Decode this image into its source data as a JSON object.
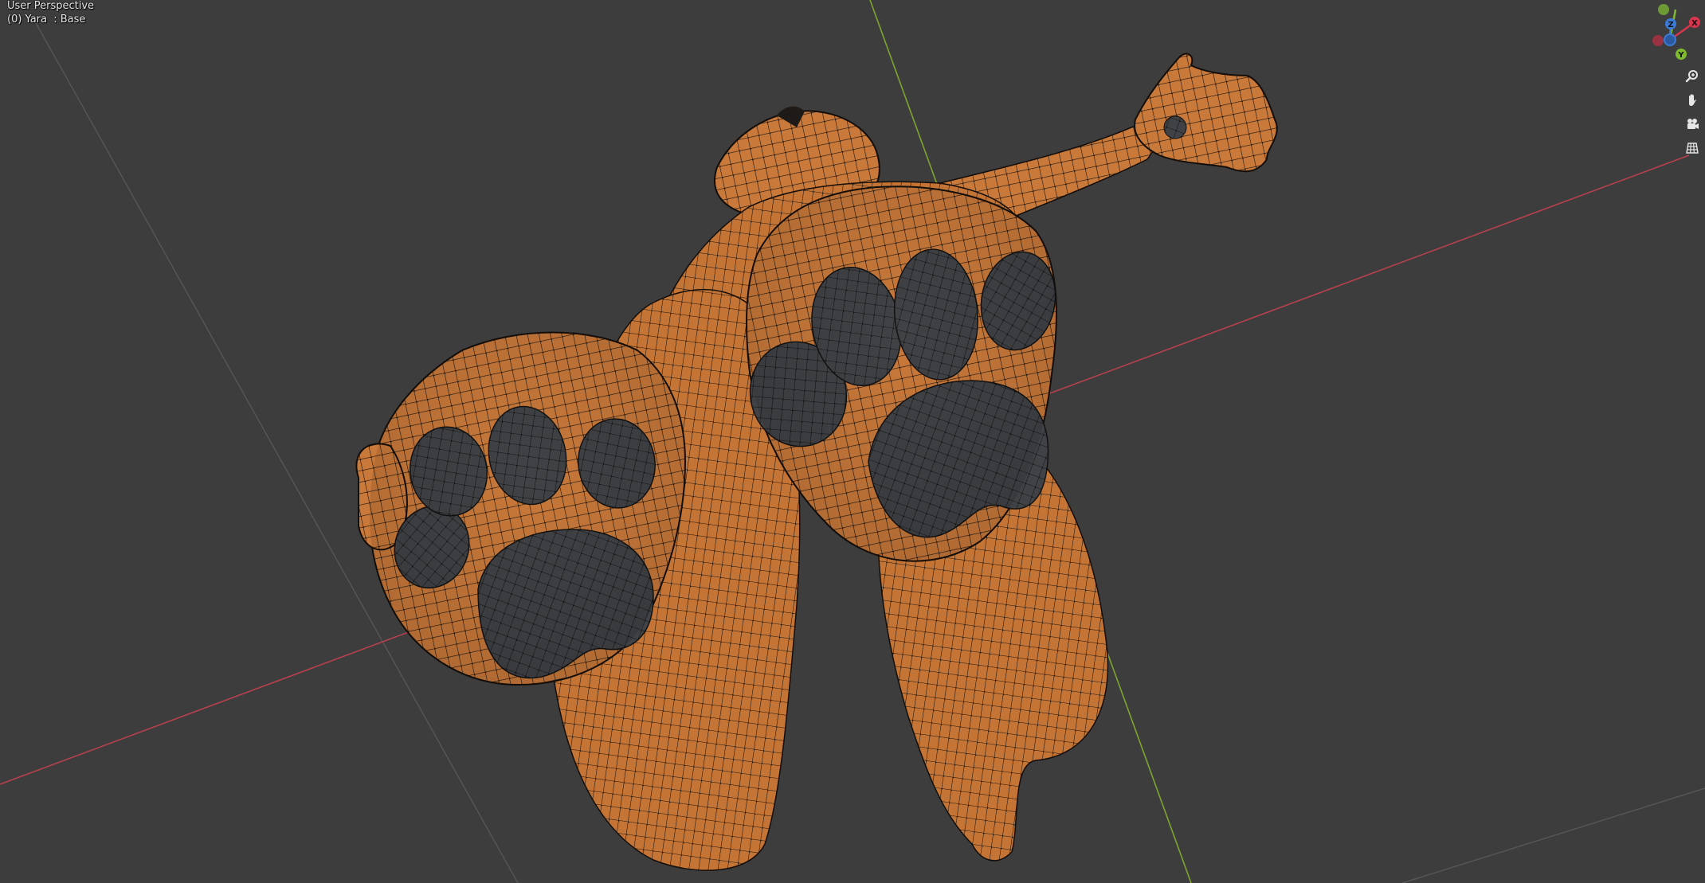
{
  "viewport": {
    "view_name": "User Perspective",
    "object_info": "(0) Yara  : Base"
  },
  "gizmo": {
    "x_label": "X",
    "y_label": "Y",
    "z_label": "Z",
    "colors": {
      "x": "#d9364d",
      "y": "#7fba2e",
      "z": "#3b7bd8",
      "x_neg": "#9a3341",
      "y_neg": "#6e9a36"
    }
  },
  "nav_tools": [
    {
      "name": "zoom-icon"
    },
    {
      "name": "hand-pan-icon"
    },
    {
      "name": "camera-view-icon"
    },
    {
      "name": "orthographic-grid-icon"
    }
  ],
  "scene_colors": {
    "background": "#3d3d3d",
    "x_axis": "#b8414f",
    "y_axis": "#7da52f",
    "grid": "#555555",
    "mesh_skin": "#c9793a",
    "mesh_pad": "#3f4145",
    "wireframe": "#1a1410"
  }
}
